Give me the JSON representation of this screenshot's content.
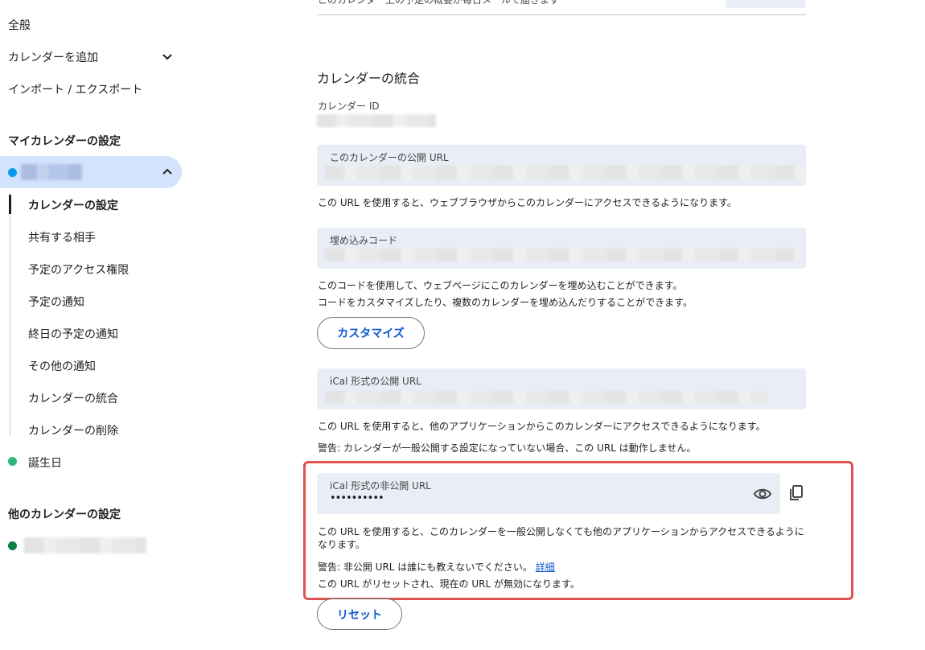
{
  "sidebar": {
    "general": "全般",
    "add_calendar": "カレンダーを追加",
    "import_export": "インポート / エクスポート",
    "my_calendars_heading": "マイカレンダーの設定",
    "sub_items": [
      {
        "label": "カレンダーの設定"
      },
      {
        "label": "共有する相手"
      },
      {
        "label": "予定のアクセス権限"
      },
      {
        "label": "予定の通知"
      },
      {
        "label": "終日の予定の通知"
      },
      {
        "label": "その他の通知"
      },
      {
        "label": "カレンダーの統合"
      },
      {
        "label": "カレンダーの削除"
      }
    ],
    "birthdays": "誕生日",
    "other_calendars_heading": "他のカレンダーの設定"
  },
  "main": {
    "top_partial_text": "このカレンダー上の予定の概要が毎日メールで届きます",
    "section_title": "カレンダーの統合",
    "calendar_id_label": "カレンダー ID",
    "public_url": {
      "label": "このカレンダーの公開 URL",
      "desc": "この URL を使用すると、ウェブブラウザからこのカレンダーにアクセスできるようになります。"
    },
    "embed_code": {
      "label": "埋め込みコード",
      "desc1": "このコードを使用して、ウェブページにこのカレンダーを埋め込むことができます。",
      "desc2": "コードをカスタマイズしたり、複数のカレンダーを埋め込んだりすることができます。",
      "customize_button": "カスタマイズ"
    },
    "ical_public": {
      "label": "iCal 形式の公開 URL",
      "desc": "この URL を使用すると、他のアプリケーションからこのカレンダーにアクセスできるようになります。",
      "warning": "警告: カレンダーが一般公開する設定になっていない場合、この URL は動作しません。"
    },
    "ical_private": {
      "label": "iCal 形式の非公開 URL",
      "masked_value": "••••••••••",
      "desc_line1": "この URL を使用すると、このカレンダーを一般公開しなくても他のアプリケーションからアクセスできるように",
      "desc_line2": "なります。",
      "warning": "警告: 非公開 URL は誰にも教えないでください。",
      "details_link": "詳細",
      "reset_note": "この URL がリセットされ、現在の URL が無効になります。",
      "reset_button": "リセット"
    }
  },
  "colors": {
    "selected_bg": "#d3e3fd",
    "calendar_dot_blue": "#039be5",
    "birthday_dot": "#33b679",
    "other_dot": "#0b8043",
    "highlight_border": "#e05252",
    "link": "#0b57d0"
  },
  "icons": [
    "chevron-down-icon",
    "chevron-up-icon",
    "eye-icon",
    "copy-icon"
  ]
}
